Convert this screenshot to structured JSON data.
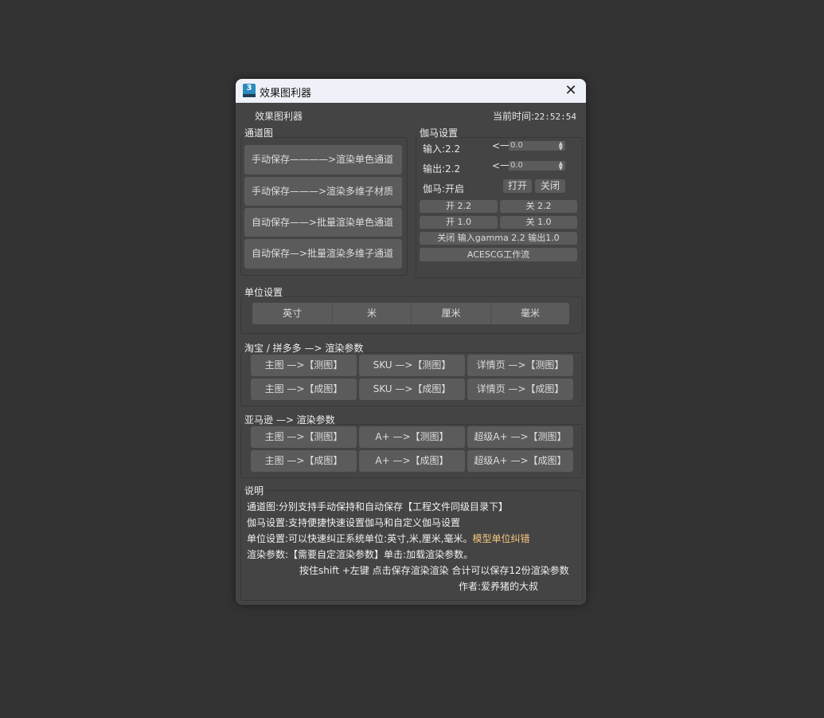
{
  "window": {
    "title": "效果图利器",
    "icon_label": "3"
  },
  "header": {
    "app_name": "效果图利器",
    "time_label": "当前时间:",
    "time_value": "22:52:54"
  },
  "channel": {
    "label": "通道图",
    "buttons": [
      "手动保存————>渲染单色通道",
      "手动保存———>渲染多维子材质",
      "自动保存——>批量渲染单色通道",
      "自动保存—>批量渲染多维子通道"
    ]
  },
  "gamma": {
    "label": "伽马设置",
    "input_label": "输入:2.2",
    "output_label": "输出:2.2",
    "arrow": "<一",
    "input_value": "0.0",
    "output_value": "0.0",
    "status": "伽马:开启",
    "on": "打开",
    "off": "关闭",
    "presets": [
      "开 2.2",
      "关 2.2",
      "开 1.0",
      "关 1.0"
    ],
    "close_io": "关闭 输入gamma 2.2 输出1.0",
    "aces": "ACESCG工作流"
  },
  "units": {
    "label": "单位设置",
    "buttons": [
      "英寸",
      "米",
      "厘米",
      "毫米"
    ]
  },
  "taobao": {
    "label": "淘宝 / 拼多多 —> 渲染参数",
    "buttons": [
      "主图 —>【测图】",
      "SKU —>【测图】",
      "详情页 —>【测图】",
      "主图 —>【成图】",
      "SKU —>【成图】",
      "详情页 —>【成图】"
    ]
  },
  "amazon": {
    "label": "亚马逊 —> 渲染参数",
    "buttons": [
      "主图 —>【测图】",
      "A+ —>【测图】",
      "超级A+ —>【测图】",
      "主图 —>【成图】",
      "A+ —>【成图】",
      "超级A+ —>【成图】"
    ]
  },
  "notes": {
    "label": "说明",
    "line1": "通道图:分别支持手动保持和自动保存【工程文件同级目录下】",
    "line2": "伽马设置:支持便捷快速设置伽马和自定义伽马设置",
    "line3": "单位设置:可以快速纠正系统单位:英寸,米,厘米,毫米。",
    "line3_highlight": "模型单位纠错",
    "line4": "渲染参数:【需要自定渲染参数】单击:加载渲染参数。",
    "line5": "按住shift +左键 点击保存渲染渲染 合计可以保存12份渲染参数",
    "line6": "作者:爱养猪的大叔"
  },
  "colors": {
    "highlight": "#f5c77e"
  }
}
